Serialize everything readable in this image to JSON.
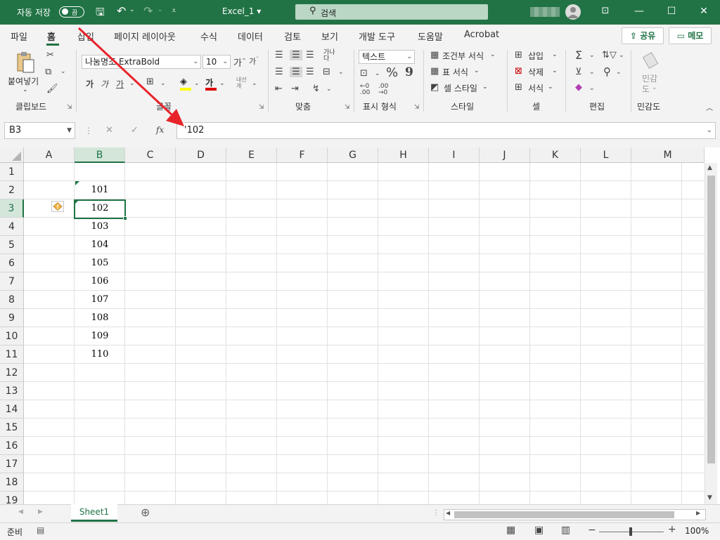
{
  "titlebar": {
    "autosave_label": "자동 저장",
    "autosave_state": "끔",
    "file_name": "Excel_1 ▾",
    "search_label": "검색",
    "accent": "#217346"
  },
  "tabs": [
    "파일",
    "홈",
    "삽입",
    "페이지 레이아웃",
    "수식",
    "데이터",
    "검토",
    "보기",
    "개발 도구",
    "도움말",
    "Acrobat"
  ],
  "share": {
    "share_label": "공유",
    "memo_label": "메모"
  },
  "ribbon": {
    "clipboard": {
      "paste_label": "붙여넣기",
      "group_label": "클립보드"
    },
    "font": {
      "font_name": "나눔명조 ExtraBold",
      "font_size": "10",
      "bold": "가",
      "italic": "가",
      "underline": "가",
      "font_color_glyph": "가",
      "group_label": "글꼴"
    },
    "alignment": {
      "group_label": "맞춤"
    },
    "number": {
      "format": "텍스트",
      "percent": "%",
      "comma": "9",
      "group_label": "표시 형식"
    },
    "styles": {
      "conditional": "조건부 서식",
      "table": "표 서식",
      "cell": "셀 스타일",
      "group_label": "스타일"
    },
    "cells": {
      "insert": "삽입",
      "delete": "삭제",
      "format": "서식",
      "group_label": "셀"
    },
    "editing": {
      "group_label": "편집"
    },
    "sensitivity": {
      "label_line1": "민감",
      "label_line2": "도",
      "group_label": "민감도"
    }
  },
  "formula_bar": {
    "name_box": "B3",
    "formula": "'102",
    "fx": "fx"
  },
  "grid": {
    "columns": [
      "A",
      "B",
      "C",
      "D",
      "E",
      "F",
      "G",
      "H",
      "I",
      "J",
      "K",
      "L",
      "M"
    ],
    "rows": [
      "1",
      "2",
      "3",
      "4",
      "5",
      "6",
      "7",
      "8",
      "9",
      "10",
      "11",
      "12",
      "13",
      "14",
      "15",
      "16",
      "17",
      "18",
      "19"
    ],
    "b_values": [
      "101",
      "102",
      "103",
      "104",
      "105",
      "106",
      "107",
      "108",
      "109",
      "110"
    ]
  },
  "sheets": {
    "active": "Sheet1"
  },
  "status": {
    "ready": "준비",
    "zoom": "100%"
  }
}
